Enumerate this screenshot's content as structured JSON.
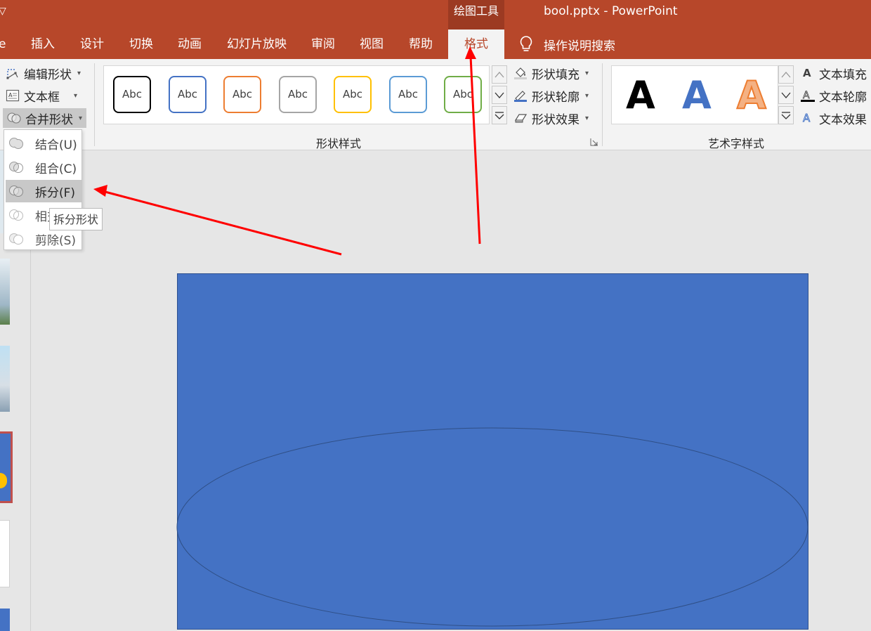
{
  "app": {
    "quick_access_glyph": "▽",
    "contextual_group": "绘图工具",
    "doc_title": "bool.pptx  -  PowerPoint"
  },
  "tabs": [
    {
      "label": "e"
    },
    {
      "label": "插入"
    },
    {
      "label": "设计"
    },
    {
      "label": "切换"
    },
    {
      "label": "动画"
    },
    {
      "label": "幻灯片放映"
    },
    {
      "label": "审阅"
    },
    {
      "label": "视图"
    },
    {
      "label": "帮助"
    },
    {
      "label": "格式",
      "active": true
    }
  ],
  "tell_me": "操作说明搜索",
  "insert_shapes": {
    "edit_shape": "编辑形状",
    "text_box": "文本框",
    "merge_shapes": "合并形状"
  },
  "shape_styles": {
    "group_label": "形状样式",
    "preset_text": "Abc",
    "presets": [
      {
        "border": "#000000"
      },
      {
        "border": "#4472c4"
      },
      {
        "border": "#ed7d31"
      },
      {
        "border": "#a5a5a5"
      },
      {
        "border": "#ffc000"
      },
      {
        "border": "#5b9bd5"
      },
      {
        "border": "#70ad47"
      }
    ],
    "fill": "形状填充",
    "outline": "形状轮廓",
    "effects": "形状效果"
  },
  "wordart": {
    "group_label": "艺术字样式",
    "sample": "A",
    "samples": [
      {
        "style": "black",
        "color": "#000000"
      },
      {
        "style": "blue",
        "color": "#4472c4"
      },
      {
        "style": "orange-outline",
        "color": "#ed7d31"
      }
    ],
    "text_fill": "文本填充",
    "text_outline": "文本轮廓",
    "text_effects": "文本效果"
  },
  "merge_menu": {
    "items": [
      {
        "label": "结合(U)"
      },
      {
        "label": "组合(C)"
      },
      {
        "label": "拆分(F)",
        "highlighted": true
      },
      {
        "label": "相交(I)"
      },
      {
        "label": "剪除(S)"
      }
    ],
    "tooltip": "拆分形状"
  },
  "colors": {
    "accent": "#b7472a",
    "shape_fill": "#4472c4",
    "annotation_arrow": "#ff0000"
  }
}
